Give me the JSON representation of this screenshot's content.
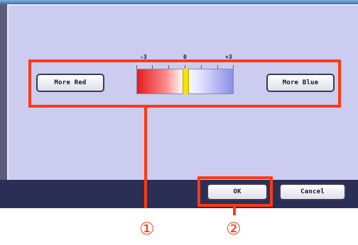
{
  "scale": {
    "min_label": "-3",
    "mid_label": "0",
    "max_label": "+3",
    "current_value": 0
  },
  "buttons": {
    "more_red": "More Red",
    "more_blue": "More Blue",
    "ok": "OK",
    "cancel": "Cancel"
  },
  "callouts": {
    "first": "①",
    "second": "②"
  },
  "colors": {
    "highlight": "#ff3a12",
    "panel": "#ccccf0",
    "marker": "#f5e400"
  }
}
